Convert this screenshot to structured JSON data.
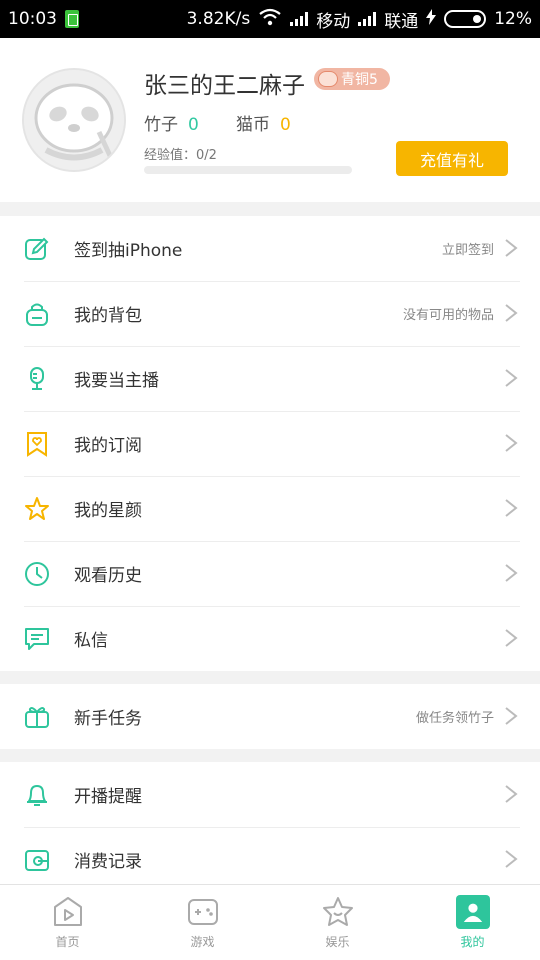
{
  "status_bar": {
    "time": "10:03",
    "net_speed": "3.82K/s",
    "carrier1": "移动",
    "carrier2": "联通",
    "battery": "12%"
  },
  "profile": {
    "username": "张三的王二麻子",
    "level_badge": "青铜5",
    "bamboo_label": "竹子",
    "bamboo_value": "0",
    "coin_label": "猫币",
    "coin_value": "0",
    "exp_text": "经验值：0/2",
    "exp_progress": 0,
    "recharge_label": "充值有礼"
  },
  "menu_group_1": [
    {
      "label": "签到抽iPhone",
      "hint": "立即签到",
      "icon": "sign-in-icon"
    },
    {
      "label": "我的背包",
      "hint": "没有可用的物品",
      "icon": "backpack-icon"
    },
    {
      "label": "我要当主播",
      "hint": "",
      "icon": "microphone-icon"
    },
    {
      "label": "我的订阅",
      "hint": "",
      "icon": "subscription-heart-icon"
    },
    {
      "label": "我的星颜",
      "hint": "",
      "icon": "star-icon"
    },
    {
      "label": "观看历史",
      "hint": "",
      "icon": "clock-icon"
    },
    {
      "label": "私信",
      "hint": "",
      "icon": "message-icon"
    }
  ],
  "menu_group_2": [
    {
      "label": "新手任务",
      "hint": "做任务领竹子",
      "icon": "gift-icon"
    }
  ],
  "menu_group_3": [
    {
      "label": "开播提醒",
      "hint": "",
      "icon": "bell-icon"
    },
    {
      "label": "消费记录",
      "hint": "",
      "icon": "wallet-icon"
    }
  ],
  "tabs": [
    {
      "label": "首页",
      "icon": "home-play-icon",
      "active": false
    },
    {
      "label": "游戏",
      "icon": "gamepad-icon",
      "active": false
    },
    {
      "label": "娱乐",
      "icon": "star-outline-icon",
      "active": false
    },
    {
      "label": "我的",
      "icon": "profile-icon",
      "active": true
    }
  ],
  "colors": {
    "accent_green": "#2ec59c",
    "accent_orange": "#f7b500",
    "background": "#f2f2f2"
  }
}
